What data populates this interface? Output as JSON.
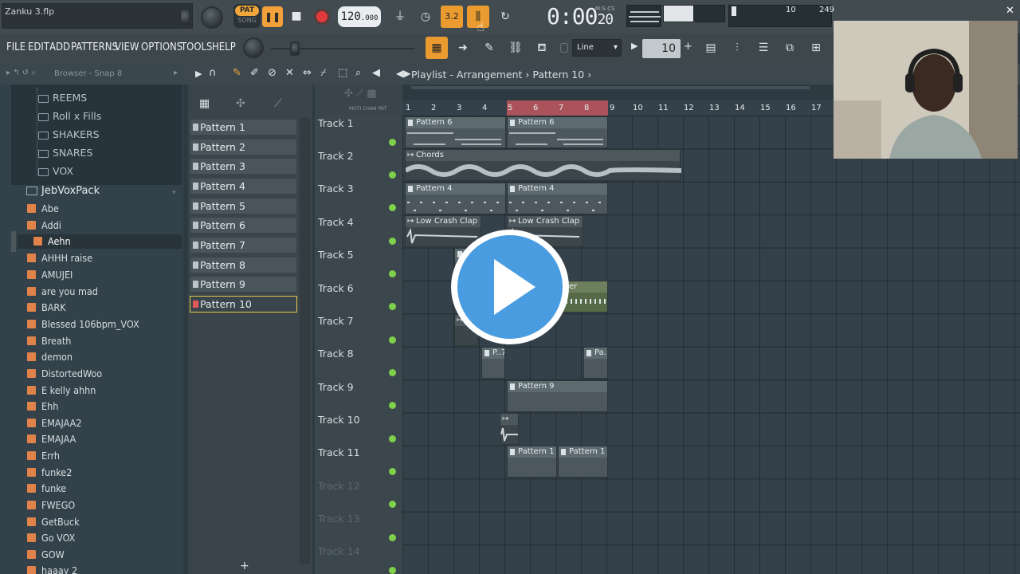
{
  "window": {
    "title": "Zanku 3.flp"
  },
  "transport": {
    "pat_label": "PAT",
    "song_label": "SONG",
    "tempo_int": "120",
    "tempo_dec": ".000",
    "time_main": "0:00",
    "time_ms": "20",
    "time_unit": "M:S:CS",
    "tool_32": "3.2",
    "cpu": "10",
    "mem": "249"
  },
  "menu": [
    "FILE",
    "EDIT",
    "ADD",
    "PATTERNS",
    "VIEW",
    "OPTIONS",
    "TOOLS",
    "HELP"
  ],
  "toolbar": {
    "snap_mode": "Line",
    "step_value": "10"
  },
  "browser": {
    "header": "Browser - Snap 8",
    "subfolders": [
      "REEMS",
      "Roll x Fills",
      "SHAKERS",
      "SNARES",
      "VOX"
    ],
    "pack": "JebVoxPack",
    "files": [
      "Abe",
      "Addi",
      "Aehn",
      "AHHH raise",
      "AMUJEI",
      "are you mad",
      "BARK",
      "Blessed 106bpm_VOX",
      "Breath",
      "demon",
      "DistortedWoo",
      "E kelly ahhn",
      "Ehh",
      "EMAJAA2",
      "EMAJAA",
      "Errh",
      "funke2",
      "funke",
      "FWEGO",
      "GetBuck",
      "Go VOX",
      "GOW",
      "haaay 2"
    ]
  },
  "playlist": {
    "title": "Playlist - Arrangement",
    "current_pattern": "Pattern 10",
    "patterns": [
      "Pattern 1",
      "Pattern 2",
      "Pattern 3",
      "Pattern 4",
      "Pattern 5",
      "Pattern 6",
      "Pattern 7",
      "Pattern 8",
      "Pattern 9",
      "Pattern 10"
    ],
    "tracks": [
      "Track 1",
      "Track 2",
      "Track 3",
      "Track 4",
      "Track 5",
      "Track 6",
      "Track 7",
      "Track 8",
      "Track 9",
      "Track 10",
      "Track 11",
      "Track 12",
      "Track 13",
      "Track 14"
    ],
    "bars": [
      "1",
      "2",
      "3",
      "4",
      "5",
      "6",
      "7",
      "8",
      "9",
      "10",
      "11",
      "12",
      "13",
      "14",
      "15",
      "16",
      "17"
    ],
    "clip_labels": {
      "t1a": "Pattern 6",
      "t1b": "Pattern 6",
      "t2": "Chords",
      "t3a": "Pattern 4",
      "t3b": "Pattern 4",
      "t4a": "Low Crash Clap",
      "t4b": "Low Crash Clap",
      "t6": "er",
      "t8a": "P..7",
      "t8b": "Pa..",
      "t9": "Pattern 9",
      "t11a": "Pattern 1",
      "t11b": "Pattern 1"
    }
  },
  "colors": {
    "accent": "#f0a63a",
    "play_overlay": "#4a9ce0",
    "loop": "#c9585e"
  }
}
